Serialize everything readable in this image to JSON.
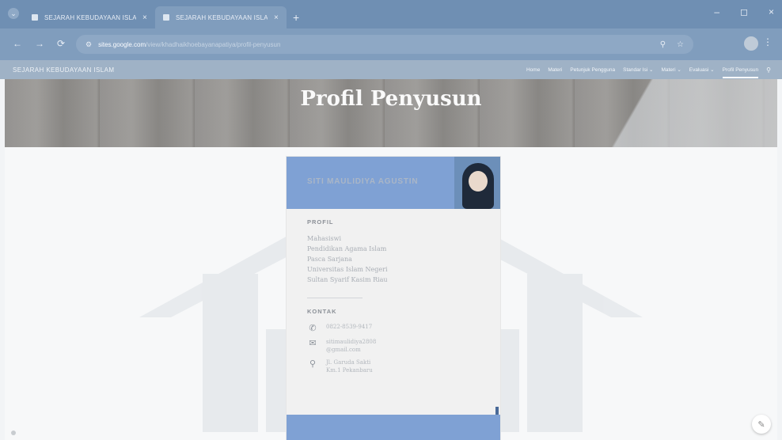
{
  "browser": {
    "tabs": [
      {
        "title": "SEJARAH KEBUDAYAAN ISLAM",
        "close": "×"
      },
      {
        "title": "SEJARAH KEBUDAYAAN ISLAM",
        "close": "×"
      }
    ],
    "new_tab": "+",
    "controls": {
      "minimize": "–",
      "maximize": "◻",
      "close": "×"
    },
    "url_host": "sites.google.com",
    "url_path": "/view/khadhaikhoebayanapatiya/profil-penyusun",
    "nav": {
      "back": "←",
      "forward": "→",
      "reload": "⟳"
    }
  },
  "site": {
    "title": "SEJARAH KEBUDAYAAN ISLAM",
    "nav_items": [
      {
        "label": "Home",
        "active": false
      },
      {
        "label": "Materi",
        "active": false
      },
      {
        "label": "Petunjuk Pengguna",
        "active": false
      },
      {
        "label": "Standar Isi ⌄",
        "active": false
      },
      {
        "label": "Materi ⌄",
        "active": false
      },
      {
        "label": "Evaluasi ⌄",
        "active": false
      },
      {
        "label": "Profil Penyusun",
        "active": true
      }
    ]
  },
  "hero": {
    "title": "Profil Penyusun"
  },
  "card": {
    "name": "SITI MAULIDIYA AGUSTIN",
    "profile_heading": "PROFIL",
    "profile_lines": [
      "Mahasiswi",
      "Pendidikan Agama Islam",
      "Pasca Sarjana",
      "Universitas Islam Negeri",
      "Sultan Syarif Kasim Riau"
    ],
    "contact_heading": "KONTAK",
    "contacts": [
      {
        "icon": "phone-icon",
        "glyph": "✆",
        "lines": [
          "0822-8539-9417"
        ]
      },
      {
        "icon": "mail-icon",
        "glyph": "✉",
        "lines": [
          "sitimaulidiya2808",
          "@gmail.com"
        ]
      },
      {
        "icon": "location-pin-icon",
        "glyph": "⚲",
        "lines": [
          "Jl. Garuda Sakti",
          "Km.1 Pekanbaru"
        ]
      }
    ]
  },
  "colors": {
    "accent": "#7fa1d4",
    "chrome": "#6f8fb3"
  },
  "edit_glyph": "✎"
}
